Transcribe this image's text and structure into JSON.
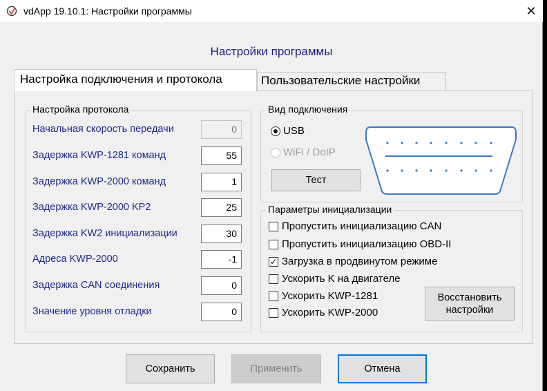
{
  "window": {
    "title": "vdApp 19.10.1:  Настройки программы",
    "app_icon": "vdapp-logo-icon",
    "close_glyph": "✕"
  },
  "heading": "Настройки программы",
  "tabs": [
    {
      "label": "Настройка подключения и протокола",
      "active": true
    },
    {
      "label": "Пользовательские настройки",
      "active": false
    }
  ],
  "protocol": {
    "title": "Настройка протокола",
    "fields": [
      {
        "label": "Начальная скорость передачи",
        "value": "0",
        "disabled": true
      },
      {
        "label": "Задержка KWP-1281 команд",
        "value": "55"
      },
      {
        "label": "Задержка KWP-2000 команд",
        "value": "1"
      },
      {
        "label": "Задержка KWP-2000 KP2",
        "value": "25"
      },
      {
        "label": "Задержка KW2 инициализации",
        "value": "30"
      },
      {
        "label": "Адреса KWP-2000",
        "value": "-1"
      },
      {
        "label": "Задержка CAN соединения",
        "value": "0"
      },
      {
        "label": "Значение уровня отладки",
        "value": "0"
      }
    ]
  },
  "connection": {
    "title": "Вид подключения",
    "usb_label": "USB",
    "usb_selected": true,
    "wifi_label": "WiFi / DoIP",
    "wifi_selected": false,
    "test_button": "Тест",
    "connector_icon": "obd-connector-icon",
    "connector_color": "#3a78c2"
  },
  "init": {
    "title": "Параметры инициализации",
    "options": [
      {
        "label": "Пропустить инициализацию CAN",
        "checked": false
      },
      {
        "label": "Пропустить инициализацию OBD-II",
        "checked": false
      },
      {
        "label": "Загрузка в продвинутом режиме",
        "checked": true
      },
      {
        "label": "Ускорить K на двигателе",
        "checked": false
      },
      {
        "label": "Ускорить KWP-1281",
        "checked": false
      },
      {
        "label": "Ускорить KWP-2000",
        "checked": false
      }
    ],
    "restore_button_line1": "Восстановить",
    "restore_button_line2": "настройки"
  },
  "footer": {
    "save": "Сохранить",
    "apply": "Применить",
    "cancel": "Отмена"
  },
  "colors": {
    "label_blue": "#1d2a8a",
    "focus_blue": "#0078d7"
  }
}
